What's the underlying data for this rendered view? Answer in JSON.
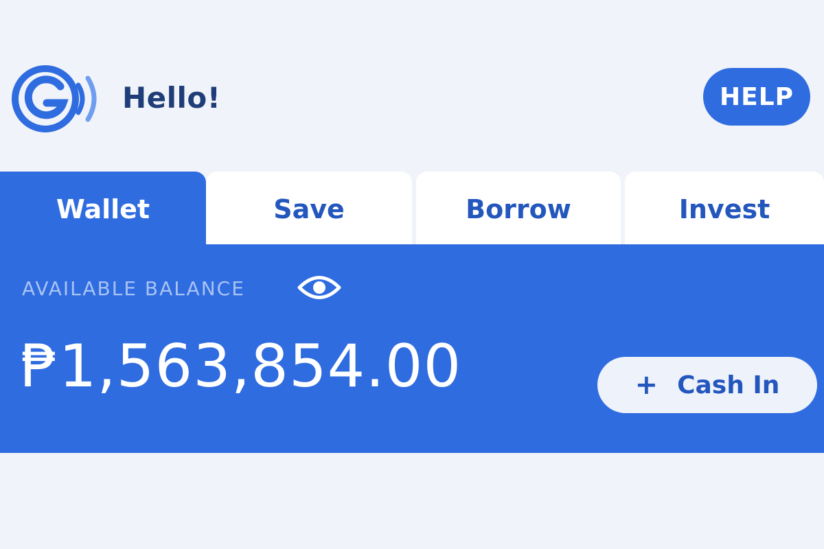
{
  "header": {
    "greeting": "Hello!",
    "help_label": "HELP",
    "logo_icon": "g-signal-logo-icon"
  },
  "tabs": [
    {
      "label": "Wallet",
      "active": true
    },
    {
      "label": "Save",
      "active": false
    },
    {
      "label": "Borrow",
      "active": false
    },
    {
      "label": "Invest",
      "active": false
    }
  ],
  "wallet": {
    "balance_label": "AVAILABLE BALANCE",
    "balance_amount": "₱1,563,854.00",
    "eye_icon": "eye-icon",
    "cash_in_icon": "+",
    "cash_in_label": "Cash In"
  },
  "colors": {
    "primary": "#2f6ce0",
    "text_dark": "#1f3d78",
    "tab_text": "#2457bd",
    "background": "#f0f3f9",
    "label_muted": "#a9c3f3"
  }
}
